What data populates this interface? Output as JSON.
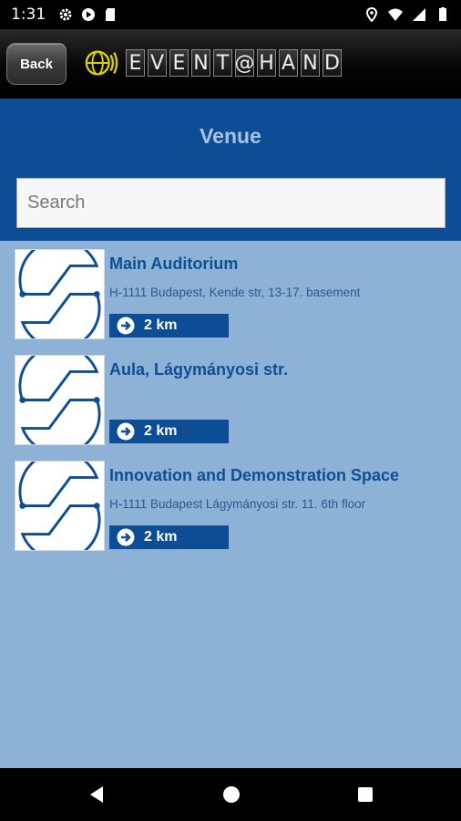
{
  "status_bar": {
    "time": "1:31",
    "left_icons": [
      "gear-icon",
      "play-store-icon",
      "sd-card-icon"
    ],
    "right_icons": [
      "location-icon",
      "wifi-icon",
      "signal-icon",
      "battery-icon"
    ]
  },
  "header": {
    "back_label": "Back",
    "logo_letters": [
      "E",
      "V",
      "E",
      "N",
      "T",
      "@",
      "H",
      "A",
      "N",
      "D"
    ]
  },
  "page": {
    "title": "Venue",
    "search_placeholder": "Search"
  },
  "venues": [
    {
      "name": "Main Auditorium",
      "address": "H-1111 Budapest, Kende str, 13-17. basement",
      "distance": "2 km"
    },
    {
      "name": "Aula, Lágymányosi str.",
      "address": "",
      "distance": "2 km"
    },
    {
      "name": "Innovation and Demonstration Space",
      "address": "H-1111 Budapest Lágymányosi str. 11. 6th floor",
      "distance": "2 km"
    }
  ],
  "colors": {
    "brand_blue": "#0d4d96",
    "content_bg": "#8eb2d5",
    "title_text": "#a9c2e3",
    "logo_yellow": "#d8d000"
  },
  "nav_bar": {
    "buttons": [
      "back-triangle-icon",
      "home-circle-icon",
      "recents-square-icon"
    ]
  }
}
